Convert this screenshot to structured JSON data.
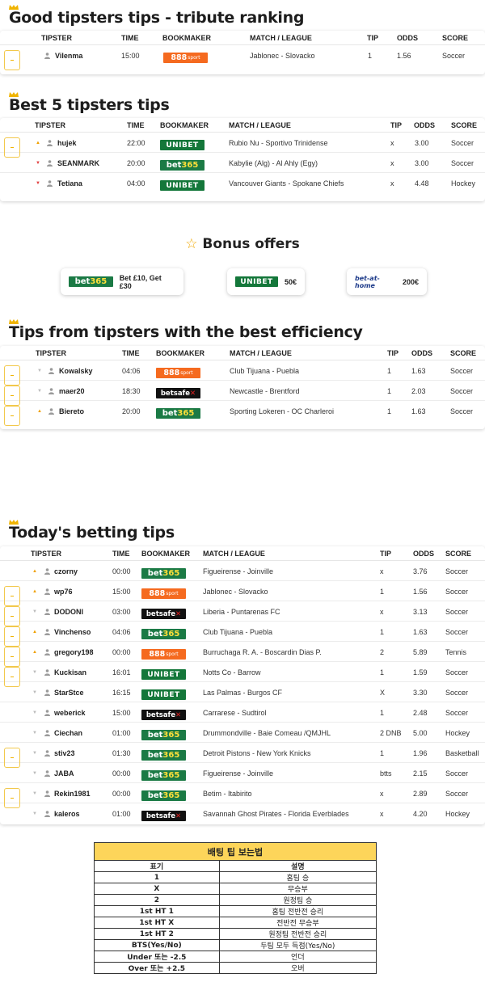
{
  "columns": {
    "tipster": "TIPSTER",
    "time": "TIME",
    "bookmaker": "BOOKMAKER",
    "match": "MATCH / LEAGUE",
    "tip": "TIP",
    "odds": "ODDS",
    "score": "SCORE"
  },
  "sections": {
    "good": {
      "title": "Good tipsters tips - tribute ranking",
      "rows": [
        {
          "tipster": "Vilenma",
          "time": "15:00",
          "bookmaker": "888",
          "match": "Jablonec - Slovacko",
          "tip": "1",
          "odds": "1.56",
          "score": "Soccer",
          "star": true,
          "arrow": ""
        }
      ]
    },
    "best5": {
      "title": "Best 5 tipsters tips",
      "rows": [
        {
          "tipster": "hujek",
          "time": "22:00",
          "bookmaker": "unibet",
          "match": "Rubio Nu - Sportivo Trinidense",
          "tip": "x",
          "odds": "3.00",
          "score": "Soccer",
          "star": true,
          "arrow": "up"
        },
        {
          "tipster": "SEANMARK",
          "time": "20:00",
          "bookmaker": "bet365",
          "match": "Kabylie (Alg) - Al Ahly (Egy)",
          "tip": "x",
          "odds": "3.00",
          "score": "Soccer",
          "star": false,
          "arrow": "down-red"
        },
        {
          "tipster": "Tetiana",
          "time": "04:00",
          "bookmaker": "unibet",
          "match": "Vancouver Giants - Spokane Chiefs",
          "tip": "x",
          "odds": "4.48",
          "score": "Hockey",
          "star": false,
          "arrow": "down-red"
        }
      ]
    },
    "efficiency": {
      "title": "Tips from tipsters with the best efficiency",
      "rows": [
        {
          "tipster": "Kowalsky",
          "time": "04:06",
          "bookmaker": "888",
          "match": "Club Tijuana - Puebla",
          "tip": "1",
          "odds": "1.63",
          "score": "Soccer",
          "star": true,
          "arrow": "down"
        },
        {
          "tipster": "maer20",
          "time": "18:30",
          "bookmaker": "betsafe",
          "match": "Newcastle - Brentford",
          "tip": "1",
          "odds": "2.03",
          "score": "Soccer",
          "star": true,
          "arrow": "down"
        },
        {
          "tipster": "Biereto",
          "time": "20:00",
          "bookmaker": "bet365",
          "match": "Sporting Lokeren - OC Charleroi",
          "tip": "1",
          "odds": "1.63",
          "score": "Soccer",
          "star": true,
          "arrow": "up"
        }
      ]
    },
    "today": {
      "title": "Today's betting tips",
      "rows": [
        {
          "tipster": "czorny",
          "time": "00:00",
          "bookmaker": "bet365",
          "match": "Figueirense - Joinville",
          "tip": "x",
          "odds": "3.76",
          "score": "Soccer",
          "star": false,
          "arrow": "up"
        },
        {
          "tipster": "wp76",
          "time": "15:00",
          "bookmaker": "888",
          "match": "Jablonec - Slovacko",
          "tip": "1",
          "odds": "1.56",
          "score": "Soccer",
          "star": true,
          "arrow": "up"
        },
        {
          "tipster": "DODONI",
          "time": "03:00",
          "bookmaker": "betsafe",
          "match": "Liberia - Puntarenas FC",
          "tip": "x",
          "odds": "3.13",
          "score": "Soccer",
          "star": true,
          "arrow": "down"
        },
        {
          "tipster": "Vinchenso",
          "time": "04:06",
          "bookmaker": "bet365",
          "match": "Club Tijuana - Puebla",
          "tip": "1",
          "odds": "1.63",
          "score": "Soccer",
          "star": true,
          "arrow": "up"
        },
        {
          "tipster": "gregory198",
          "time": "00:00",
          "bookmaker": "888",
          "match": "Burruchaga R. A. - Boscardin Dias P.",
          "tip": "2",
          "odds": "5.89",
          "score": "Tennis",
          "star": true,
          "arrow": "up"
        },
        {
          "tipster": "Kuckisan",
          "time": "16:01",
          "bookmaker": "unibet",
          "match": "Notts Co - Barrow",
          "tip": "1",
          "odds": "1.59",
          "score": "Soccer",
          "star": true,
          "arrow": "down"
        },
        {
          "tipster": "StarStce",
          "time": "16:15",
          "bookmaker": "unibet",
          "match": "Las Palmas - Burgos CF",
          "tip": "X",
          "odds": "3.30",
          "score": "Soccer",
          "star": false,
          "arrow": "down"
        },
        {
          "tipster": "weberick",
          "time": "15:00",
          "bookmaker": "betsafe",
          "match": "Carrarese - Sudtirol",
          "tip": "1",
          "odds": "2.48",
          "score": "Soccer",
          "star": false,
          "arrow": "down"
        },
        {
          "tipster": "Ciechan",
          "time": "01:00",
          "bookmaker": "bet365",
          "match": "Drummondville - Baie Comeau /QMJHL",
          "tip": "2 DNB",
          "odds": "5.00",
          "score": "Hockey",
          "star": false,
          "arrow": "down"
        },
        {
          "tipster": "stiv23",
          "time": "01:30",
          "bookmaker": "bet365",
          "match": "Detroit Pistons - New York Knicks",
          "tip": "1",
          "odds": "1.96",
          "score": "Basketball",
          "star": true,
          "arrow": "down"
        },
        {
          "tipster": "JABA",
          "time": "00:00",
          "bookmaker": "bet365",
          "match": "Figueirense - Joinville",
          "tip": "btts",
          "odds": "2.15",
          "score": "Soccer",
          "star": false,
          "arrow": "down"
        },
        {
          "tipster": "Rekin1981",
          "time": "00:00",
          "bookmaker": "bet365",
          "match": "Betim - Itabirito",
          "tip": "x",
          "odds": "2.89",
          "score": "Soccer",
          "star": true,
          "arrow": "down"
        },
        {
          "tipster": "kaleros",
          "time": "01:00",
          "bookmaker": "betsafe",
          "match": "Savannah Ghost Pirates - Florida Everblades",
          "tip": "x",
          "odds": "4.20",
          "score": "Hockey",
          "star": false,
          "arrow": "down"
        }
      ]
    }
  },
  "bonus": {
    "title": "Bonus offers",
    "star_glyph": "☆",
    "offers": [
      {
        "bookmaker": "bet365",
        "text": "Bet £10, Get £30"
      },
      {
        "bookmaker": "unibet",
        "text": "50€"
      },
      {
        "bookmaker": "betathome",
        "text": "200€"
      }
    ]
  },
  "bookmaker_logos": {
    "bet365": [
      "bet",
      "365"
    ],
    "unibet": "UNIBET",
    "888": [
      "888",
      "sport"
    ],
    "betsafe": [
      "betsafe",
      "✕"
    ],
    "betathome": "bet-at-home"
  },
  "legend": {
    "title": "배팅 팁 보는법",
    "headers": [
      "표기",
      "설명"
    ],
    "rows": [
      [
        "1",
        "홈팀 승"
      ],
      [
        "X",
        "무승부"
      ],
      [
        "2",
        "원정팀 승"
      ],
      [
        "1st HT 1",
        "홈팀 전반전 승리"
      ],
      [
        "1st HT X",
        "전반전 무승부"
      ],
      [
        "1st HT 2",
        "원정팀 전반전 승리"
      ],
      [
        "BTS(Yes/No)",
        "두팀 모두 득점(Yes/No)"
      ],
      [
        "Under 또는 -2.5",
        "언더"
      ],
      [
        "Over 또는 +2.5",
        "오버"
      ]
    ]
  },
  "colors": {
    "accent": "#f0b400",
    "bet365": "#1b7a45",
    "unibet": "#14773a",
    "888": "#f56a1f",
    "betsafe": "#111111"
  }
}
